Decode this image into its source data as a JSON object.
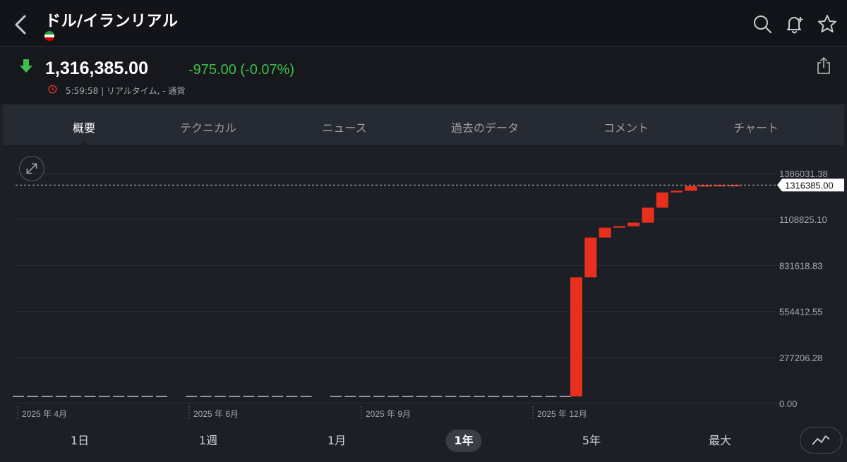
{
  "header": {
    "title": "ドル/イランリアル",
    "icons": [
      "back-icon",
      "search-icon",
      "bell-plus-icon",
      "star-icon",
      "flag-icon"
    ]
  },
  "quote": {
    "price": "1,316,385.00",
    "change": "-975.00 (-0.07%)",
    "time_info": "5:59:58 | リアルタイム, - 通貨",
    "colors": {
      "down": "#3fbf4d",
      "clock": "#e03a2e"
    }
  },
  "tabs": [
    {
      "label": "概要",
      "active": true
    },
    {
      "label": "テクニカル",
      "active": false
    },
    {
      "label": "ニュース",
      "active": false
    },
    {
      "label": "過去のデータ",
      "active": false
    },
    {
      "label": "コメント",
      "active": false
    },
    {
      "label": "チャート",
      "active": false
    }
  ],
  "chart_data": {
    "type": "candlestick",
    "y_ticks": [
      "1386031.38",
      "1108825.10",
      "831618.83",
      "554412.55",
      "277206.28",
      "0.00"
    ],
    "y_tick_values": [
      1386031.38,
      1108825.1,
      831618.83,
      554412.55,
      277206.28,
      0
    ],
    "ylim": [
      0,
      1386031.38
    ],
    "x_ticks": [
      "2025 年 4月",
      "2025 年 6月",
      "2025 年 9月",
      "2025 年 12月"
    ],
    "current_value_label": "1316385.00",
    "current_value": 1316385.0,
    "grid": true,
    "colors": {
      "down": "#e8301f",
      "flat": "#b8bac0",
      "grid": "#2c2f37",
      "current": "#ffffff"
    },
    "flat_segments": [
      {
        "count": 11,
        "value": 42000
      },
      {
        "count": 9,
        "value": 42000
      },
      {
        "count": 17,
        "value": 42000
      }
    ],
    "candles": [
      {
        "open": 42000,
        "close": 760000
      },
      {
        "open": 760000,
        "close": 1000000
      },
      {
        "open": 1000000,
        "close": 1060000
      },
      {
        "open": 1060000,
        "close": 1068000
      },
      {
        "open": 1068000,
        "close": 1090000
      },
      {
        "open": 1090000,
        "close": 1180000
      },
      {
        "open": 1180000,
        "close": 1272000
      },
      {
        "open": 1272000,
        "close": 1282000
      },
      {
        "open": 1282000,
        "close": 1310000
      },
      {
        "open": 1310000,
        "close": 1316000
      },
      {
        "open": 1316000,
        "close": 1317000
      },
      {
        "open": 1317000,
        "close": 1316385
      }
    ]
  },
  "periods": [
    {
      "label": "1日",
      "active": false
    },
    {
      "label": "1週",
      "active": false
    },
    {
      "label": "1月",
      "active": false
    },
    {
      "label": "1年",
      "active": true
    },
    {
      "label": "5年",
      "active": false
    },
    {
      "label": "最大",
      "active": false
    }
  ]
}
